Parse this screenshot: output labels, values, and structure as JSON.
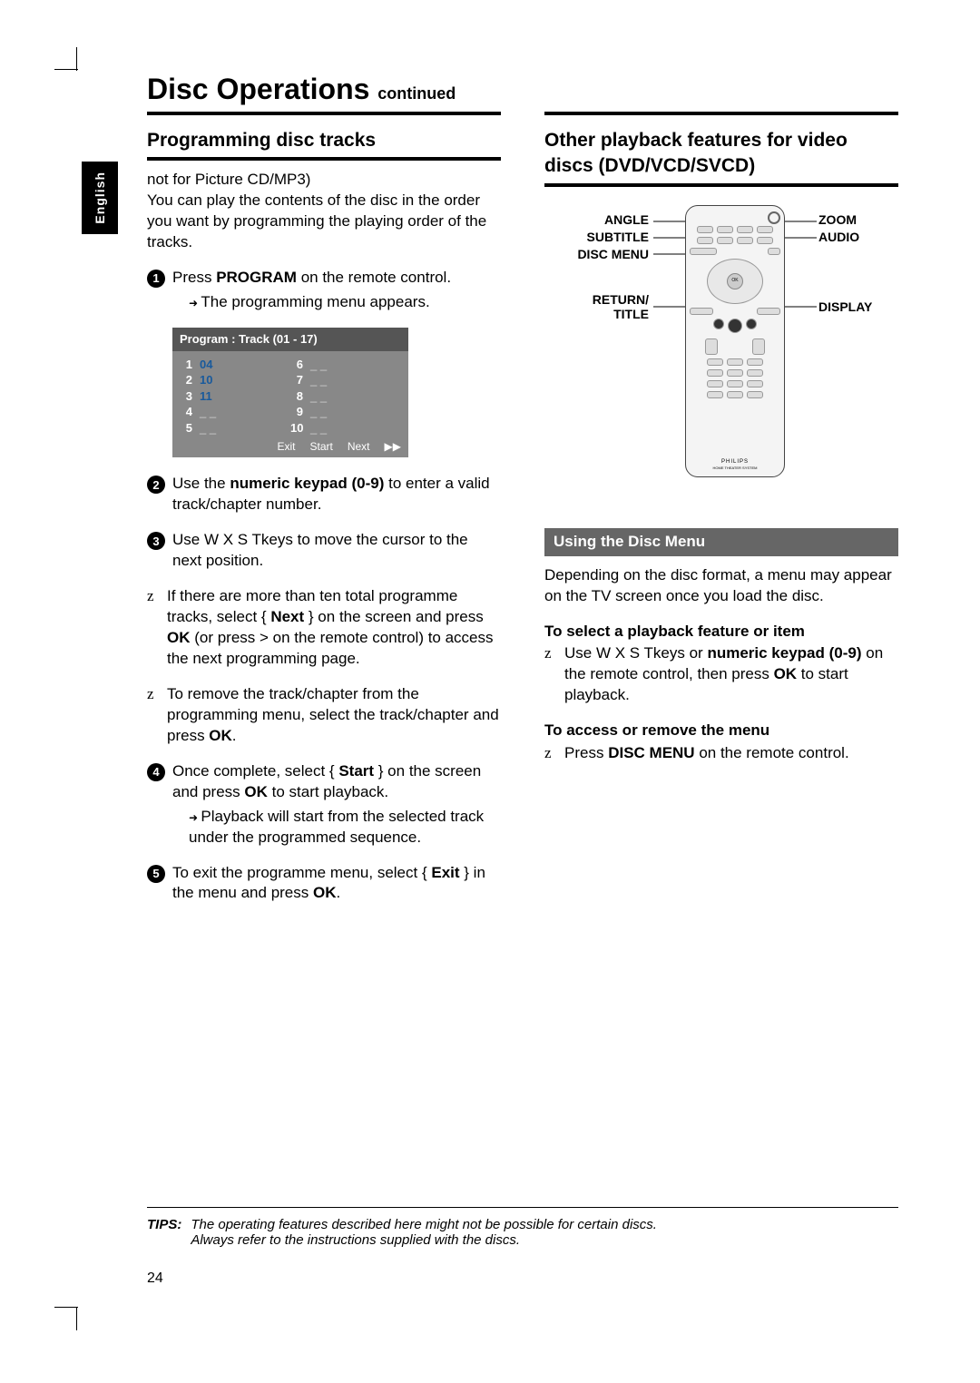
{
  "lang_tab": "English",
  "page_title": "Disc Operations",
  "page_title_cont": "continued",
  "left": {
    "heading": "Programming disc tracks",
    "note": "not for Picture CD/MP3)",
    "intro": "You can play the contents of the disc in the order you want by programming the playing order of the tracks.",
    "step1_a": "Press ",
    "step1_b": "PROGRAM",
    "step1_c": " on the remote control.",
    "step1_sub": "The programming menu appears.",
    "table_header": "Program : Track (01 - 17)",
    "table_rows_left": [
      {
        "idx": "1",
        "val": "04"
      },
      {
        "idx": "2",
        "val": "10"
      },
      {
        "idx": "3",
        "val": "11"
      },
      {
        "idx": "4",
        "val": "_ _"
      },
      {
        "idx": "5",
        "val": "_ _"
      }
    ],
    "table_rows_right": [
      {
        "idx": "6",
        "val": "_ _"
      },
      {
        "idx": "7",
        "val": "_ _"
      },
      {
        "idx": "8",
        "val": "_ _"
      },
      {
        "idx": "9",
        "val": "_ _"
      },
      {
        "idx": "10",
        "val": "_ _"
      }
    ],
    "table_footer": [
      "Exit",
      "Start",
      "Next",
      "▶▶"
    ],
    "step2_a": "Use the ",
    "step2_b": "numeric keypad (0-9)",
    "step2_c": " to enter a valid track/chapter number.",
    "step3": "Use  W X S Tkeys to move the cursor to the next position.",
    "bullet_a1": "If there are more than ten total programme tracks, select { ",
    "bullet_a2": "Next",
    "bullet_a3": " } on the screen and press ",
    "bullet_a4": "OK",
    "bullet_a5": " (or press > on the remote control) to access the next programming page.",
    "bullet_b1": "To remove the track/chapter from the programming menu, select the track/chapter and press ",
    "bullet_b2": "OK",
    "bullet_b3": ".",
    "step4_a": "Once complete, select { ",
    "step4_b": "Start",
    "step4_c": " } on the screen and press ",
    "step4_d": "OK",
    "step4_e": " to start playback.",
    "step4_sub": "Playback will start from the selected track under the programmed sequence.",
    "step5_a": "To exit the programme menu, select { ",
    "step5_b": "Exit",
    "step5_c": " } in the menu and press ",
    "step5_d": "OK",
    "step5_e": "."
  },
  "right": {
    "heading": "Other playback features for video discs (DVD/VCD/SVCD)",
    "labels": {
      "angle": "ANGLE",
      "subtitle": "SUBTITLE",
      "disc_menu": "DISC MENU",
      "return_title": "RETURN/\nTITLE",
      "zoom": "ZOOM",
      "audio": "AUDIO",
      "display": "DISPLAY"
    },
    "remote_brand": "PHILIPS",
    "remote_sub": "HOME THEATER SYSTEM",
    "gray_heading": "Using the Disc Menu",
    "para1": "Depending on the disc format, a menu may appear on the TV screen once you load the disc.",
    "sub_h1": "To select a playback feature or item",
    "b1_a": "Use  W X S Tkeys or ",
    "b1_b": "numeric keypad (0-9)",
    "b1_c": " on the remote control, then press ",
    "b1_d": "OK",
    "b1_e": " to start playback.",
    "sub_h2": "To access or remove the menu",
    "b2_a": "Press ",
    "b2_b": "DISC MENU",
    "b2_c": " on the remote control."
  },
  "tips_label": "TIPS:",
  "tips_body": "The operating features described here might not be possible for certain discs.\nAlways refer to the instructions supplied with the discs.",
  "page_number": "24"
}
